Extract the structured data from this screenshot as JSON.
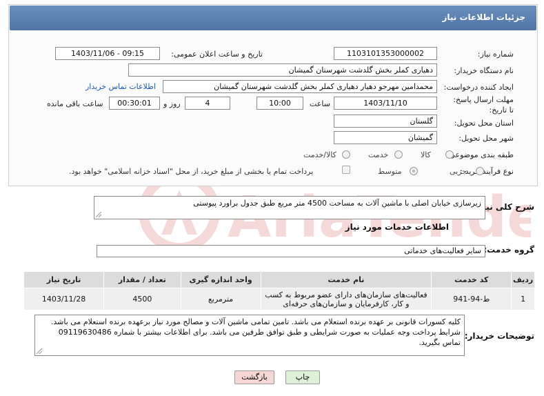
{
  "header": {
    "title": "جزئیات اطلاعات نیاز"
  },
  "fields": {
    "need_number_label": "شماره نیاز:",
    "need_number": "1103101353000002",
    "announce_label": "تاریخ و ساعت اعلان عمومی:",
    "announce_value": "1403/11/06 - 09:15",
    "buyer_org_label": "نام دستگاه خریدار:",
    "buyer_org": "دهیاری کملر بخش گلدشت شهرستان گمیشان",
    "creator_label": "ایجاد کننده درخواست:",
    "creator": "محمدامین مهرجو دهیار دهیاری کملر بخش گلدشت شهرستان گمیشان",
    "contact_link": "اطلاعات تماس خریدار",
    "deadline_label": "مهلت ارسال پاسخ: تا تاریخ:",
    "deadline_date": "1403/11/10",
    "time_label": "ساعت",
    "deadline_time": "10:00",
    "days_value": "4",
    "days_label": "روز و",
    "remaining_time": "00:30:01",
    "remaining_label": "ساعت باقی مانده",
    "province_label": "استان محل تحویل:",
    "province": "گلستان",
    "city_label": "شهر محل تحویل:",
    "city": "گمیشان",
    "category_label": "طبقه بندی موضوعی:",
    "category_options": [
      "کالا",
      "خدمت",
      "کالا/خدمت"
    ],
    "process_label": "نوع فرآیند خرید :",
    "process_options": [
      "جزیی",
      "متوسط"
    ],
    "payment_note": "پرداخت تمام یا بخشی از مبلغ خرید، از محل \"اسناد خزانه اسلامی\" خواهد بود."
  },
  "description": {
    "label": "شرح کلی نیاز:",
    "text": "زیرسازی خیابان اصلی با ماشین آلات به مساحت 4500 متر مربع طبق جدول براورد پیوستی"
  },
  "services": {
    "section_title": "اطلاعات خدمات مورد نیاز",
    "group_label": "گروه خدمت:",
    "group_value": "سایر فعالیت‌های خدماتی",
    "columns": [
      "ردیف",
      "کد خدمت",
      "نام خدمت",
      "واحد اندازه گیری",
      "تعداد / مقدار",
      "تاریخ نیاز"
    ],
    "rows": [
      {
        "row": "1",
        "code": "ط-94-941",
        "name": "فعالیت‌های سازمان‌های دارای عضو مربوط به کسب و کار، کارفرمایان و سازمان‌های حرفه‌ای",
        "unit": "مترمربع",
        "qty": "4500",
        "date": "1403/11/28"
      }
    ]
  },
  "buyer_notes": {
    "label": "توضیحات خریدار:",
    "text": "کلیه کسورات قانونی بر عهده برنده استعلام می باشد. تامین تمامی ماشین آلات و مصالح مورد نیاز برعهده برنده استعلام می باشد. شرایط پرداخت وجه عملیات به صورت شرایطی و طبق توافق طرفین می باشد. برای اطلاعات بیشتر با شماره 09119630486 تماس بگیرید."
  },
  "buttons": {
    "print": "چاپ",
    "back": "بازگشت"
  },
  "colors": {
    "header": "#5a7eaf",
    "link": "#1f56c2",
    "back_button": "#f7d6d6",
    "print_button": "#dff0d8"
  }
}
